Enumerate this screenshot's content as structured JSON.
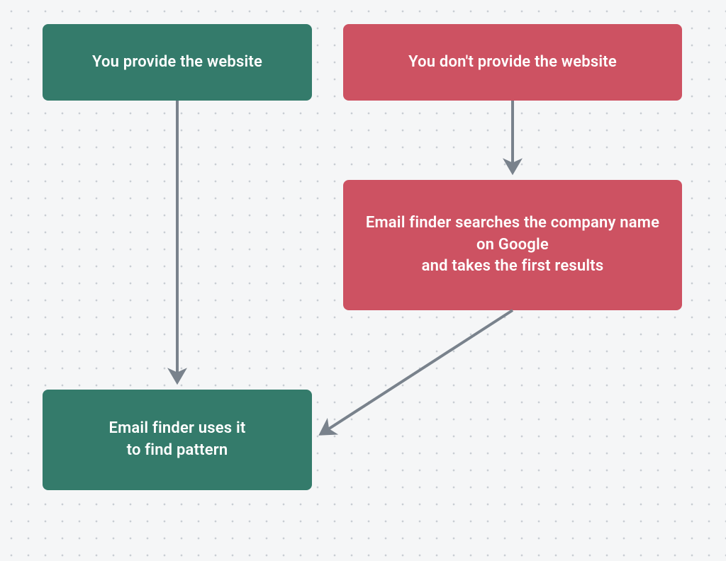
{
  "diagram": {
    "nodes": {
      "provide": {
        "text": "You provide the website",
        "color": "green"
      },
      "dont_provide": {
        "text": "You don't provide the website",
        "color": "red"
      },
      "google": {
        "text": "Email finder searches the company name on Google\nand takes the first results",
        "color": "red"
      },
      "pattern": {
        "text": "Email finder uses it\nto find pattern",
        "color": "green"
      }
    },
    "arrows": [
      {
        "from": "provide",
        "to": "pattern"
      },
      {
        "from": "dont_provide",
        "to": "google"
      },
      {
        "from": "google",
        "to": "pattern"
      }
    ],
    "colors": {
      "green": "#347b6b",
      "red": "#cd5262",
      "arrow": "#79828c",
      "bg": "#f5f6f7",
      "dot": "#c8cdd3"
    }
  }
}
